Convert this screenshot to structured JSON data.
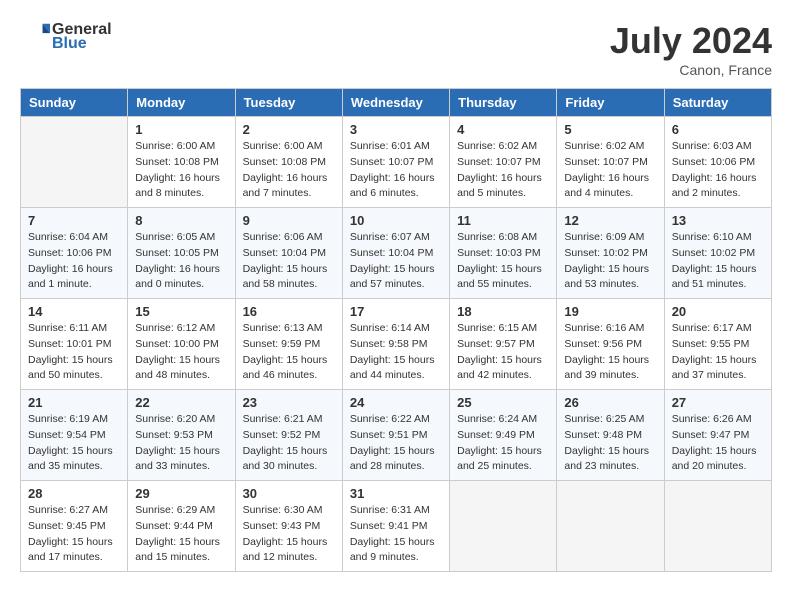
{
  "header": {
    "logo_line1": "General",
    "logo_line2": "Blue",
    "month": "July 2024",
    "location": "Canon, France"
  },
  "days_of_week": [
    "Sunday",
    "Monday",
    "Tuesday",
    "Wednesday",
    "Thursday",
    "Friday",
    "Saturday"
  ],
  "weeks": [
    [
      {
        "day": "",
        "empty": true
      },
      {
        "day": "1",
        "sunrise": "Sunrise: 6:00 AM",
        "sunset": "Sunset: 10:08 PM",
        "daylight": "Daylight: 16 hours and 8 minutes."
      },
      {
        "day": "2",
        "sunrise": "Sunrise: 6:00 AM",
        "sunset": "Sunset: 10:08 PM",
        "daylight": "Daylight: 16 hours and 7 minutes."
      },
      {
        "day": "3",
        "sunrise": "Sunrise: 6:01 AM",
        "sunset": "Sunset: 10:07 PM",
        "daylight": "Daylight: 16 hours and 6 minutes."
      },
      {
        "day": "4",
        "sunrise": "Sunrise: 6:02 AM",
        "sunset": "Sunset: 10:07 PM",
        "daylight": "Daylight: 16 hours and 5 minutes."
      },
      {
        "day": "5",
        "sunrise": "Sunrise: 6:02 AM",
        "sunset": "Sunset: 10:07 PM",
        "daylight": "Daylight: 16 hours and 4 minutes."
      },
      {
        "day": "6",
        "sunrise": "Sunrise: 6:03 AM",
        "sunset": "Sunset: 10:06 PM",
        "daylight": "Daylight: 16 hours and 2 minutes."
      }
    ],
    [
      {
        "day": "7",
        "sunrise": "Sunrise: 6:04 AM",
        "sunset": "Sunset: 10:06 PM",
        "daylight": "Daylight: 16 hours and 1 minute."
      },
      {
        "day": "8",
        "sunrise": "Sunrise: 6:05 AM",
        "sunset": "Sunset: 10:05 PM",
        "daylight": "Daylight: 16 hours and 0 minutes."
      },
      {
        "day": "9",
        "sunrise": "Sunrise: 6:06 AM",
        "sunset": "Sunset: 10:04 PM",
        "daylight": "Daylight: 15 hours and 58 minutes."
      },
      {
        "day": "10",
        "sunrise": "Sunrise: 6:07 AM",
        "sunset": "Sunset: 10:04 PM",
        "daylight": "Daylight: 15 hours and 57 minutes."
      },
      {
        "day": "11",
        "sunrise": "Sunrise: 6:08 AM",
        "sunset": "Sunset: 10:03 PM",
        "daylight": "Daylight: 15 hours and 55 minutes."
      },
      {
        "day": "12",
        "sunrise": "Sunrise: 6:09 AM",
        "sunset": "Sunset: 10:02 PM",
        "daylight": "Daylight: 15 hours and 53 minutes."
      },
      {
        "day": "13",
        "sunrise": "Sunrise: 6:10 AM",
        "sunset": "Sunset: 10:02 PM",
        "daylight": "Daylight: 15 hours and 51 minutes."
      }
    ],
    [
      {
        "day": "14",
        "sunrise": "Sunrise: 6:11 AM",
        "sunset": "Sunset: 10:01 PM",
        "daylight": "Daylight: 15 hours and 50 minutes."
      },
      {
        "day": "15",
        "sunrise": "Sunrise: 6:12 AM",
        "sunset": "Sunset: 10:00 PM",
        "daylight": "Daylight: 15 hours and 48 minutes."
      },
      {
        "day": "16",
        "sunrise": "Sunrise: 6:13 AM",
        "sunset": "Sunset: 9:59 PM",
        "daylight": "Daylight: 15 hours and 46 minutes."
      },
      {
        "day": "17",
        "sunrise": "Sunrise: 6:14 AM",
        "sunset": "Sunset: 9:58 PM",
        "daylight": "Daylight: 15 hours and 44 minutes."
      },
      {
        "day": "18",
        "sunrise": "Sunrise: 6:15 AM",
        "sunset": "Sunset: 9:57 PM",
        "daylight": "Daylight: 15 hours and 42 minutes."
      },
      {
        "day": "19",
        "sunrise": "Sunrise: 6:16 AM",
        "sunset": "Sunset: 9:56 PM",
        "daylight": "Daylight: 15 hours and 39 minutes."
      },
      {
        "day": "20",
        "sunrise": "Sunrise: 6:17 AM",
        "sunset": "Sunset: 9:55 PM",
        "daylight": "Daylight: 15 hours and 37 minutes."
      }
    ],
    [
      {
        "day": "21",
        "sunrise": "Sunrise: 6:19 AM",
        "sunset": "Sunset: 9:54 PM",
        "daylight": "Daylight: 15 hours and 35 minutes."
      },
      {
        "day": "22",
        "sunrise": "Sunrise: 6:20 AM",
        "sunset": "Sunset: 9:53 PM",
        "daylight": "Daylight: 15 hours and 33 minutes."
      },
      {
        "day": "23",
        "sunrise": "Sunrise: 6:21 AM",
        "sunset": "Sunset: 9:52 PM",
        "daylight": "Daylight: 15 hours and 30 minutes."
      },
      {
        "day": "24",
        "sunrise": "Sunrise: 6:22 AM",
        "sunset": "Sunset: 9:51 PM",
        "daylight": "Daylight: 15 hours and 28 minutes."
      },
      {
        "day": "25",
        "sunrise": "Sunrise: 6:24 AM",
        "sunset": "Sunset: 9:49 PM",
        "daylight": "Daylight: 15 hours and 25 minutes."
      },
      {
        "day": "26",
        "sunrise": "Sunrise: 6:25 AM",
        "sunset": "Sunset: 9:48 PM",
        "daylight": "Daylight: 15 hours and 23 minutes."
      },
      {
        "day": "27",
        "sunrise": "Sunrise: 6:26 AM",
        "sunset": "Sunset: 9:47 PM",
        "daylight": "Daylight: 15 hours and 20 minutes."
      }
    ],
    [
      {
        "day": "28",
        "sunrise": "Sunrise: 6:27 AM",
        "sunset": "Sunset: 9:45 PM",
        "daylight": "Daylight: 15 hours and 17 minutes."
      },
      {
        "day": "29",
        "sunrise": "Sunrise: 6:29 AM",
        "sunset": "Sunset: 9:44 PM",
        "daylight": "Daylight: 15 hours and 15 minutes."
      },
      {
        "day": "30",
        "sunrise": "Sunrise: 6:30 AM",
        "sunset": "Sunset: 9:43 PM",
        "daylight": "Daylight: 15 hours and 12 minutes."
      },
      {
        "day": "31",
        "sunrise": "Sunrise: 6:31 AM",
        "sunset": "Sunset: 9:41 PM",
        "daylight": "Daylight: 15 hours and 9 minutes."
      },
      {
        "day": "",
        "empty": true
      },
      {
        "day": "",
        "empty": true
      },
      {
        "day": "",
        "empty": true
      }
    ]
  ]
}
